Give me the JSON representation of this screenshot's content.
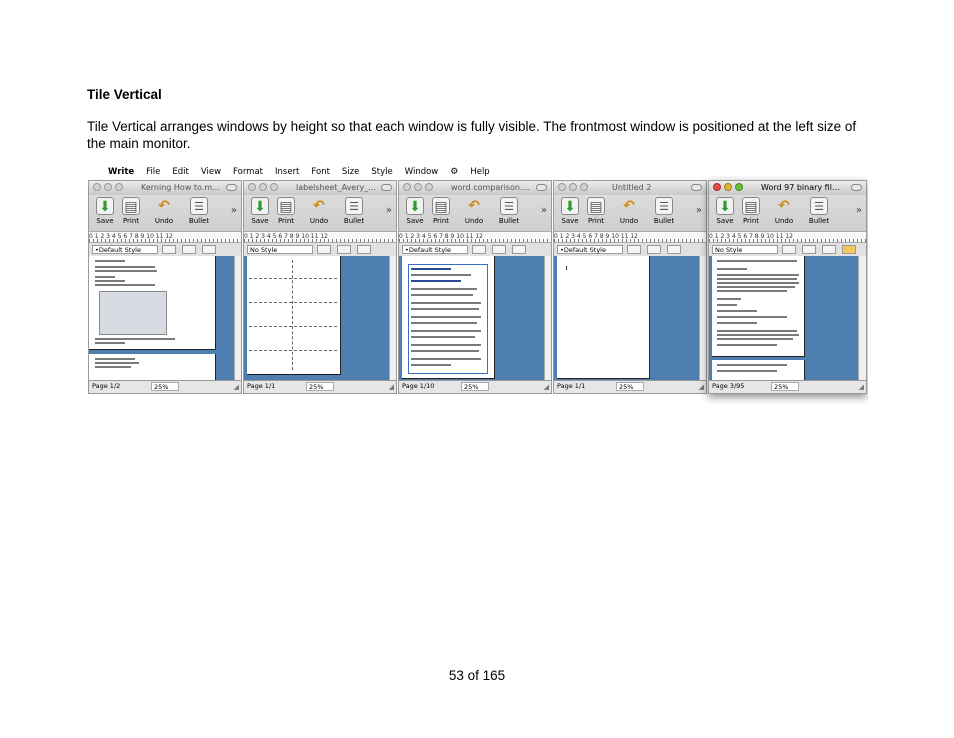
{
  "heading": "Tile Vertical",
  "paragraph": "Tile Vertical arranges windows by height so that each window is fully visible. The frontmost window is positioned at the left size of the main monitor.",
  "footer": "53 of 165",
  "screenshot": {
    "menubar": {
      "apple": "",
      "items": [
        "Write",
        "File",
        "Edit",
        "View",
        "Format",
        "Insert",
        "Font",
        "Size",
        "Style",
        "Window",
        "Help"
      ],
      "script_icon": "⚙"
    },
    "toolbar_labels": {
      "save": "Save",
      "print": "Print",
      "undo": "Undo",
      "bullet": "Bullet",
      "more": "»"
    },
    "ruler_text": "0 1 2 3 4 5 6 7 8 9 10 11 12",
    "windows": [
      {
        "title": "Kerning How to.m...",
        "style": "•Default Style",
        "page": "Page 1/2",
        "zoom": "25%"
      },
      {
        "title": "labelsheet_Avery_...",
        "style": "No Style",
        "page": "Page 1/1",
        "zoom": "25%"
      },
      {
        "title": "word comparison....",
        "style": "•Default Style",
        "page": "Page 1/10",
        "zoom": "25%"
      },
      {
        "title": "Untitled 2",
        "style": "•Default Style",
        "page": "Page 1/1",
        "zoom": "25%"
      },
      {
        "title": "Word 97 binary fil...",
        "style": "No Style",
        "page": "Page 3/95",
        "zoom": "25%"
      }
    ]
  }
}
